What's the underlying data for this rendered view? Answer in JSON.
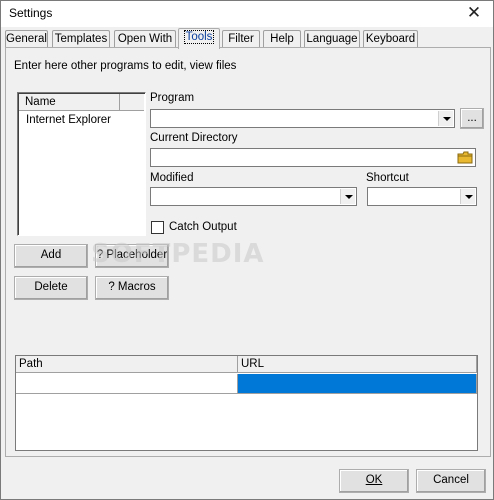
{
  "window": {
    "title": "Settings",
    "close_glyph": "✕"
  },
  "tabs": [
    {
      "label": "General"
    },
    {
      "label": "Templates"
    },
    {
      "label": "Open With"
    },
    {
      "label": "Tools",
      "active": true
    },
    {
      "label": "Filter"
    },
    {
      "label": "Help"
    },
    {
      "label": "Language"
    },
    {
      "label": "Keyboard"
    }
  ],
  "tools": {
    "intro": "Enter here other programs to edit, view files",
    "list": {
      "header": "Name",
      "items": [
        "Internet Explorer"
      ]
    },
    "program": {
      "label": "Program",
      "value": "",
      "browse_label": "..."
    },
    "current_directory": {
      "label": "Current Directory",
      "value": ""
    },
    "modified": {
      "label": "Modified",
      "value": ""
    },
    "shortcut": {
      "label": "Shortcut",
      "value": ""
    },
    "catch_output": {
      "label": "Catch Output",
      "checked": false
    },
    "buttons": {
      "add": "Add",
      "placeholder": "? Placeholder",
      "delete": "Delete",
      "macros": "? Macros"
    },
    "grid": {
      "columns": [
        "Path",
        "URL"
      ],
      "rows": [
        [
          "",
          ""
        ]
      ],
      "selected_color": "#0078d7"
    }
  },
  "watermark": "SOFTPEDIA",
  "footer": {
    "ok": "OK",
    "cancel": "Cancel"
  }
}
